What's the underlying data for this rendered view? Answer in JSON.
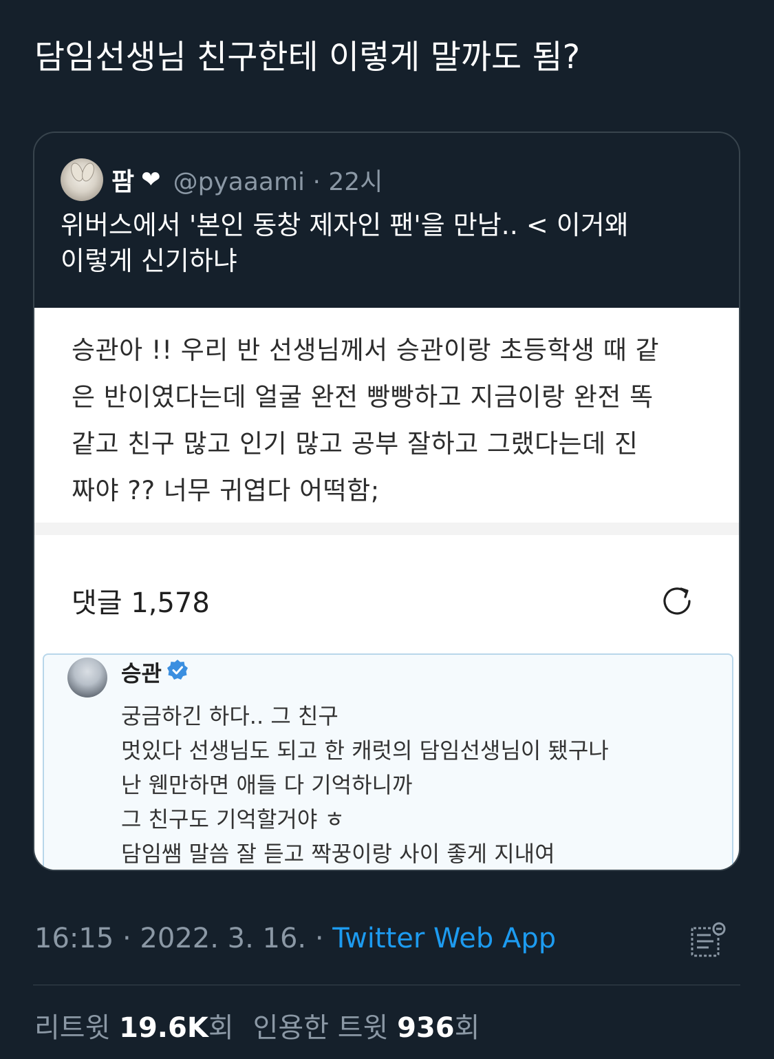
{
  "tweet": {
    "text": "담임선생님 친구한테 이렇게 말까도 됨?"
  },
  "quote": {
    "author_name": "팜",
    "author_badge": "❤",
    "handle": "@pyaaami",
    "time": "· 22시",
    "text_line1": "위버스에서 '본인 동창 제자인 팬'을 만남..  < 이거왜",
    "text_line2": "이렇게 신기하냐",
    "image": {
      "post_lines": [
        "승관아 !! 우리 반 선생님께서 승관이랑 초등학생 때 같",
        "은 반이였다는데 얼굴 완전 빵빵하고 지금이랑 완전 똑",
        "같고 친구 많고 인기 많고 공부 잘하고 그랬다는데 진",
        "짜야 ?? 너무 귀엽다 어떡함;"
      ],
      "comments_label": "댓글 1,578",
      "comment": {
        "author": "승관",
        "lines": [
          "궁금하긴 하다.. 그 친구",
          "멋있다 선생님도 되고 한 캐럿의 담임선생님이 됐구나",
          "난 웬만하면 애들 다 기억하니까",
          "그 친구도 기억할거야 ㅎ",
          "담임쌤 말씀 잘 듣고 짝꿍이랑 사이 좋게 지내여"
        ]
      }
    }
  },
  "meta": {
    "time_date": "16:15 · 2022. 3. 16. · ",
    "source": "Twitter Web App"
  },
  "stats": {
    "retweets_label": "리트윗 ",
    "retweets_count": "19.6K",
    "retweets_suffix": "회",
    "quotes_label": "인용한 트윗 ",
    "quotes_count": "936",
    "quotes_suffix": "회"
  },
  "colors": {
    "background": "#15202b",
    "accent": "#1d9bf0",
    "secondary_text": "#8b98a5",
    "verified": "#3b8fe0"
  },
  "icons": [
    "refresh-icon",
    "verified-icon",
    "analytics-icon",
    "heart-icon"
  ]
}
